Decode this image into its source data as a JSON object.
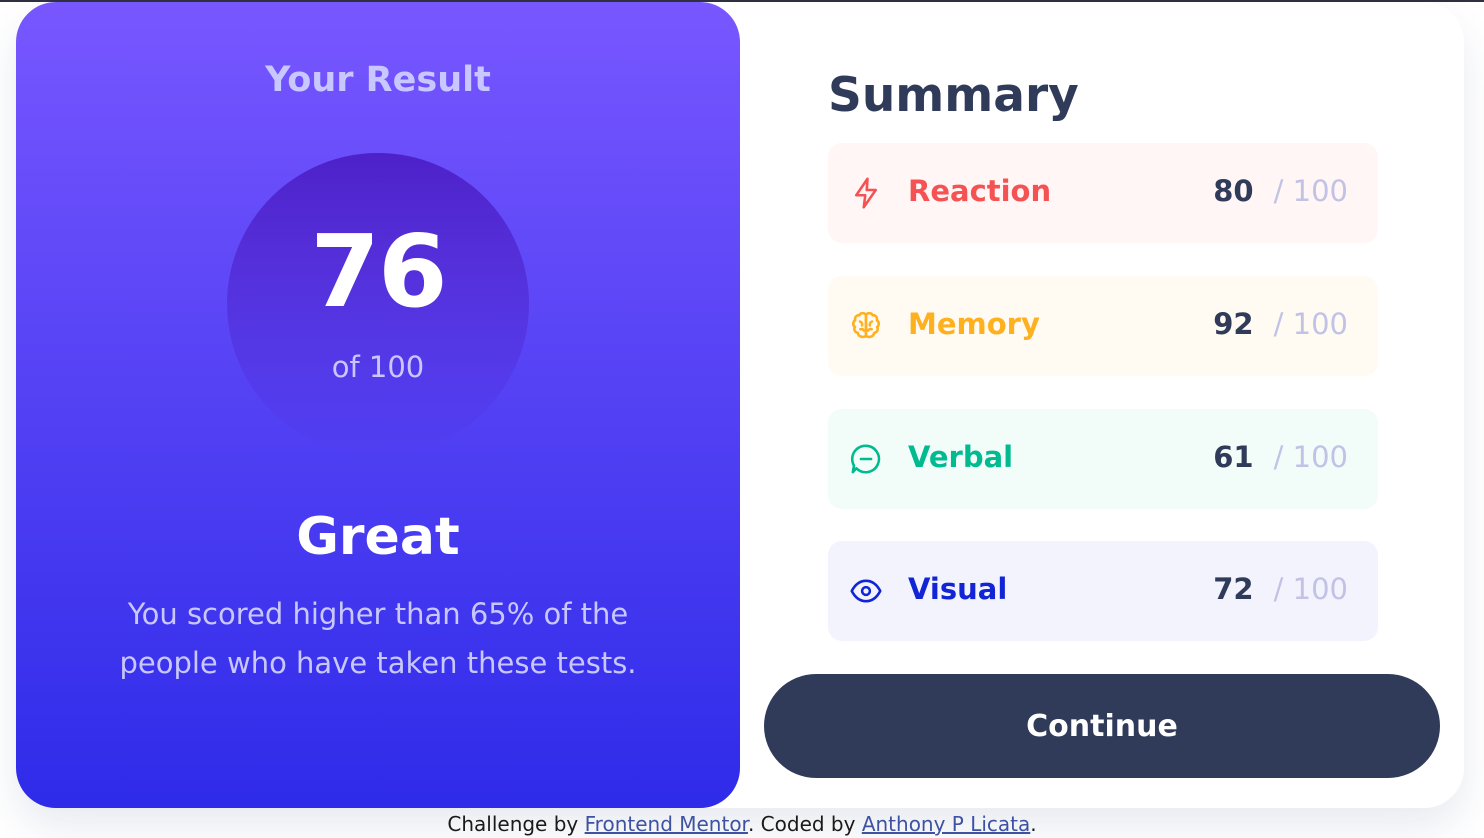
{
  "result": {
    "heading": "Your Result",
    "score": "76",
    "out_of": "of 100",
    "grade": "Great",
    "description": "You scored higher than 65% of the people who have taken these tests."
  },
  "summary": {
    "heading": "Summary",
    "items": [
      {
        "label": "Reaction",
        "score": "80",
        "max": "/ 100",
        "icon": "lightning-icon",
        "color": "#f55353",
        "bg": "#fff6f5"
      },
      {
        "label": "Memory",
        "score": "92",
        "max": "/ 100",
        "icon": "brain-icon",
        "color": "#ffb01f",
        "bg": "#fffbf2"
      },
      {
        "label": "Verbal",
        "score": "61",
        "max": "/ 100",
        "icon": "chat-bubble-icon",
        "color": "#00bb8f",
        "bg": "#f2fcf9"
      },
      {
        "label": "Visual",
        "score": "72",
        "max": "/ 100",
        "icon": "eye-icon",
        "color": "#1125d6",
        "bg": "#f3f3fd"
      }
    ]
  },
  "continue_label": "Continue",
  "attribution": {
    "prefix": "Challenge by",
    "link1": "Frontend Mentor",
    "middle": ". Coded by",
    "link2": "Anthony P Licata",
    "suffix": "."
  },
  "colors": {
    "gradient_top": "#7857ff",
    "gradient_bottom": "#2e2be9",
    "dark_navy": "#303b5a",
    "light_lavender": "#c8c7ff"
  }
}
